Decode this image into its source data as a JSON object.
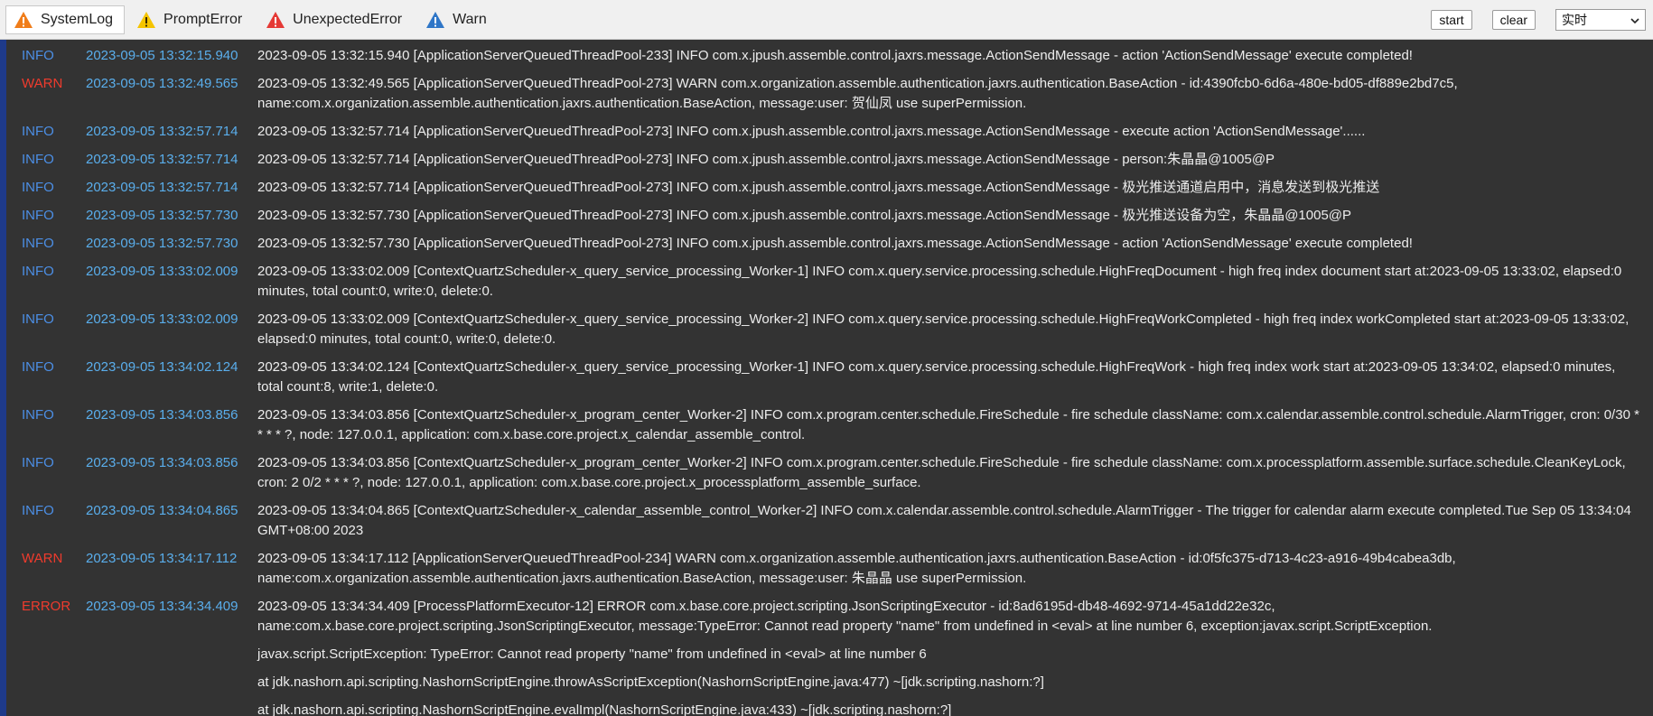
{
  "tabs": [
    {
      "label": "SystemLog",
      "icon": "warning-orange-icon",
      "color": "#f07d1a",
      "active": true
    },
    {
      "label": "PromptError",
      "icon": "warning-yellow-icon",
      "color": "#f5c400",
      "active": false
    },
    {
      "label": "UnexpectedError",
      "icon": "warning-red-icon",
      "color": "#e53935",
      "active": false
    },
    {
      "label": "Warn",
      "icon": "warning-blue-icon",
      "color": "#2f76c7",
      "active": false
    }
  ],
  "controls": {
    "start_label": "start",
    "clear_label": "clear",
    "mode_selected": "实时"
  },
  "colors": {
    "background": "#333333",
    "info": "#4c8fe6",
    "warn_error": "#ef3b2d",
    "timestamp": "#5aaeec",
    "message": "#ededed"
  },
  "logs": [
    {
      "level": "INFO",
      "time": "2023-09-05 13:32:15.940",
      "message": "2023-09-05 13:32:15.940 [ApplicationServerQueuedThreadPool-233] INFO com.x.jpush.assemble.control.jaxrs.message.ActionSendMessage - action 'ActionSendMessage' execute completed!"
    },
    {
      "level": "WARN",
      "time": "2023-09-05 13:32:49.565",
      "message": "2023-09-05 13:32:49.565 [ApplicationServerQueuedThreadPool-273] WARN com.x.organization.assemble.authentication.jaxrs.authentication.BaseAction - id:4390fcb0-6d6a-480e-bd05-df889e2bd7c5, name:com.x.organization.assemble.authentication.jaxrs.authentication.BaseAction, message:user: 贺仙凤 use superPermission."
    },
    {
      "level": "INFO",
      "time": "2023-09-05 13:32:57.714",
      "message": "2023-09-05 13:32:57.714 [ApplicationServerQueuedThreadPool-273] INFO com.x.jpush.assemble.control.jaxrs.message.ActionSendMessage - execute action 'ActionSendMessage'......"
    },
    {
      "level": "INFO",
      "time": "2023-09-05 13:32:57.714",
      "message": "2023-09-05 13:32:57.714 [ApplicationServerQueuedThreadPool-273] INFO com.x.jpush.assemble.control.jaxrs.message.ActionSendMessage - person:朱晶晶@1005@P"
    },
    {
      "level": "INFO",
      "time": "2023-09-05 13:32:57.714",
      "message": "2023-09-05 13:32:57.714 [ApplicationServerQueuedThreadPool-273] INFO com.x.jpush.assemble.control.jaxrs.message.ActionSendMessage - 极光推送通道启用中，消息发送到极光推送"
    },
    {
      "level": "INFO",
      "time": "2023-09-05 13:32:57.730",
      "message": "2023-09-05 13:32:57.730 [ApplicationServerQueuedThreadPool-273] INFO com.x.jpush.assemble.control.jaxrs.message.ActionSendMessage - 极光推送设备为空，朱晶晶@1005@P"
    },
    {
      "level": "INFO",
      "time": "2023-09-05 13:32:57.730",
      "message": "2023-09-05 13:32:57.730 [ApplicationServerQueuedThreadPool-273] INFO com.x.jpush.assemble.control.jaxrs.message.ActionSendMessage - action 'ActionSendMessage' execute completed!"
    },
    {
      "level": "INFO",
      "time": "2023-09-05 13:33:02.009",
      "message": "2023-09-05 13:33:02.009 [ContextQuartzScheduler-x_query_service_processing_Worker-1] INFO com.x.query.service.processing.schedule.HighFreqDocument - high freq index document start at:2023-09-05 13:33:02, elapsed:0 minutes, total count:0, write:0, delete:0."
    },
    {
      "level": "INFO",
      "time": "2023-09-05 13:33:02.009",
      "message": "2023-09-05 13:33:02.009 [ContextQuartzScheduler-x_query_service_processing_Worker-2] INFO com.x.query.service.processing.schedule.HighFreqWorkCompleted - high freq index workCompleted start at:2023-09-05 13:33:02, elapsed:0 minutes, total count:0, write:0, delete:0."
    },
    {
      "level": "INFO",
      "time": "2023-09-05 13:34:02.124",
      "message": "2023-09-05 13:34:02.124 [ContextQuartzScheduler-x_query_service_processing_Worker-1] INFO com.x.query.service.processing.schedule.HighFreqWork - high freq index work start at:2023-09-05 13:34:02, elapsed:0 minutes, total count:8, write:1, delete:0."
    },
    {
      "level": "INFO",
      "time": "2023-09-05 13:34:03.856",
      "message": "2023-09-05 13:34:03.856 [ContextQuartzScheduler-x_program_center_Worker-2] INFO com.x.program.center.schedule.FireSchedule - fire schedule className: com.x.calendar.assemble.control.schedule.AlarmTrigger, cron: 0/30 * * * * ?, node: 127.0.0.1, application: com.x.base.core.project.x_calendar_assemble_control."
    },
    {
      "level": "INFO",
      "time": "2023-09-05 13:34:03.856",
      "message": "2023-09-05 13:34:03.856 [ContextQuartzScheduler-x_program_center_Worker-2] INFO com.x.program.center.schedule.FireSchedule - fire schedule className: com.x.processplatform.assemble.surface.schedule.CleanKeyLock, cron: 2 0/2 * * * ?, node: 127.0.0.1, application: com.x.base.core.project.x_processplatform_assemble_surface."
    },
    {
      "level": "INFO",
      "time": "2023-09-05 13:34:04.865",
      "message": "2023-09-05 13:34:04.865 [ContextQuartzScheduler-x_calendar_assemble_control_Worker-2] INFO com.x.calendar.assemble.control.schedule.AlarmTrigger - The trigger for calendar alarm execute completed.Tue Sep 05 13:34:04 GMT+08:00 2023"
    },
    {
      "level": "WARN",
      "time": "2023-09-05 13:34:17.112",
      "message": "2023-09-05 13:34:17.112 [ApplicationServerQueuedThreadPool-234] WARN com.x.organization.assemble.authentication.jaxrs.authentication.BaseAction - id:0f5fc375-d713-4c23-a916-49b4cabea3db, name:com.x.organization.assemble.authentication.jaxrs.authentication.BaseAction, message:user: 朱晶晶 use superPermission."
    },
    {
      "level": "ERROR",
      "time": "2023-09-05 13:34:34.409",
      "message": "2023-09-05 13:34:34.409 [ProcessPlatformExecutor-12] ERROR com.x.base.core.project.scripting.JsonScriptingExecutor - id:8ad6195d-db48-4692-9714-45a1dd22e32c, name:com.x.base.core.project.scripting.JsonScriptingExecutor, message:TypeError: Cannot read property \"name\" from undefined in <eval> at line number 6, exception:javax.script.ScriptException."
    },
    {
      "level": "",
      "time": "",
      "message": "javax.script.ScriptException: TypeError: Cannot read property \"name\" from undefined in <eval> at line number 6"
    },
    {
      "level": "",
      "time": "",
      "message": "at jdk.nashorn.api.scripting.NashornScriptEngine.throwAsScriptException(NashornScriptEngine.java:477) ~[jdk.scripting.nashorn:?]"
    },
    {
      "level": "",
      "time": "",
      "message": "at jdk.nashorn.api.scripting.NashornScriptEngine.evalImpl(NashornScriptEngine.java:433) ~[jdk.scripting.nashorn:?]"
    }
  ]
}
